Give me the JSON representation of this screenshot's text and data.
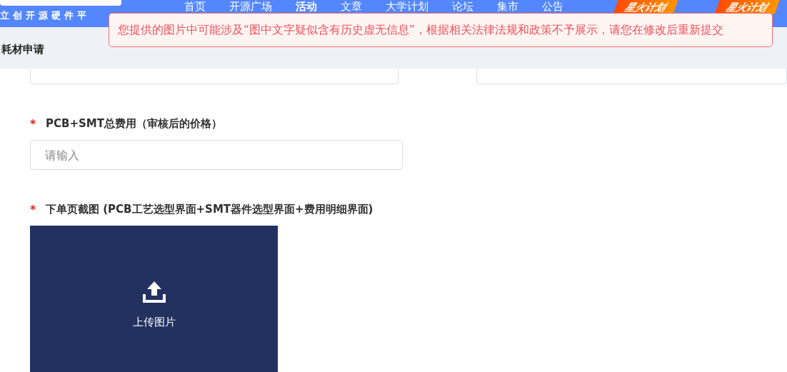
{
  "header": {
    "logo_subtitle": "立创开源硬件平",
    "nav": [
      {
        "label": "首页",
        "selected": false
      },
      {
        "label": "开源广场",
        "selected": false
      },
      {
        "label": "活动",
        "selected": true
      },
      {
        "label": "文章",
        "selected": false
      },
      {
        "label": "大学计划",
        "selected": false
      },
      {
        "label": "论坛",
        "selected": false
      },
      {
        "label": "集市",
        "selected": false
      },
      {
        "label": "公告",
        "selected": false
      }
    ],
    "badges": [
      "星火计划",
      "星火计划"
    ]
  },
  "toast": {
    "message": "您提供的图片中可能涉及“图中文字疑似含有历史虚无信息”，根据相关法律法规和政策不予展示，请您在修改后重新提交"
  },
  "page_title": "耗材申请",
  "fields": [
    {
      "kind": "input",
      "required_mark": "*",
      "label": "PCB+SMT总费用（审核后的价格）",
      "placeholder": "请输入"
    },
    {
      "kind": "upload",
      "required_mark": "*",
      "label": "下单页截图 (PCB工艺选型界面+SMT器件选型界面+费用明细界面)",
      "button": "上传图片"
    }
  ]
}
